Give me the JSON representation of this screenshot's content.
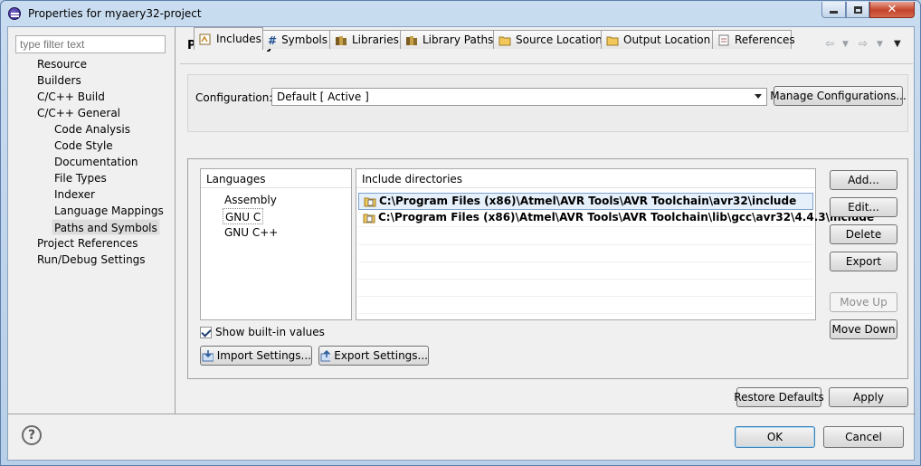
{
  "window": {
    "title": "Properties for myaery32-project"
  },
  "filter": {
    "placeholder": "type filter text"
  },
  "tree": [
    {
      "label": "Resource",
      "level": 0
    },
    {
      "label": "Builders",
      "level": 0
    },
    {
      "label": "C/C++ Build",
      "level": 0
    },
    {
      "label": "C/C++ General",
      "level": 0
    },
    {
      "label": "Code Analysis",
      "level": 1
    },
    {
      "label": "Code Style",
      "level": 1
    },
    {
      "label": "Documentation",
      "level": 1
    },
    {
      "label": "File Types",
      "level": 1
    },
    {
      "label": "Indexer",
      "level": 1
    },
    {
      "label": "Language Mappings",
      "level": 1
    },
    {
      "label": "Paths and Symbols",
      "level": 1,
      "selected": true
    },
    {
      "label": "Project References",
      "level": 0
    },
    {
      "label": "Run/Debug Settings",
      "level": 0
    }
  ],
  "page": {
    "title": "Paths and Symbols"
  },
  "configuration": {
    "label": "Configuration:",
    "value": "Default  [ Active ]",
    "manage_label": "Manage Configurations..."
  },
  "tabs": [
    {
      "label": "Includes",
      "icon": "includes-icon",
      "active": true
    },
    {
      "label": "Symbols",
      "icon": "hash-icon"
    },
    {
      "label": "Libraries",
      "icon": "library-icon"
    },
    {
      "label": "Library Paths",
      "icon": "library-path-icon"
    },
    {
      "label": "Source Location",
      "icon": "source-folder-icon"
    },
    {
      "label": "Output Location",
      "icon": "output-folder-icon"
    },
    {
      "label": "References",
      "icon": "references-icon"
    }
  ],
  "languages": {
    "header": "Languages",
    "items": [
      {
        "label": "Assembly"
      },
      {
        "label": "GNU C",
        "selected": true
      },
      {
        "label": "GNU C++"
      }
    ]
  },
  "includes": {
    "header": "Include directories",
    "rows": [
      "C:\\Program Files (x86)\\Atmel\\AVR Tools\\AVR Toolchain\\avr32\\include",
      "C:\\Program Files (x86)\\Atmel\\AVR Tools\\AVR Toolchain\\lib\\gcc\\avr32\\4.4.3\\include"
    ]
  },
  "side_buttons": {
    "add": "Add...",
    "edit": "Edit...",
    "delete": "Delete",
    "export": "Export",
    "move_up": "Move Up",
    "move_down": "Move Down"
  },
  "show_builtin": {
    "label": "Show built-in values",
    "checked": true
  },
  "settings_buttons": {
    "import": "Import Settings...",
    "export": "Export Settings..."
  },
  "footer": {
    "restore_defaults": "Restore Defaults",
    "apply": "Apply",
    "ok": "OK",
    "cancel": "Cancel",
    "help": "?"
  },
  "colors": {
    "selection_bg": "#e6f0fb",
    "selection_border": "#7da2ce",
    "titlebar": "#c9dcf0",
    "close": "#c4432a"
  }
}
